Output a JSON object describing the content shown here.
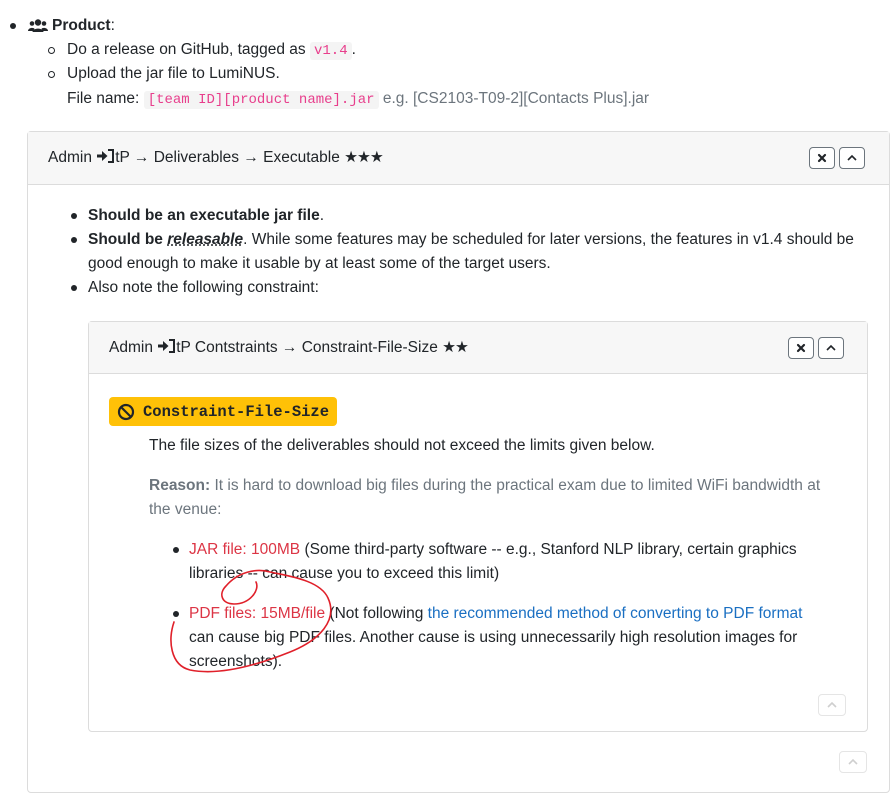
{
  "product": {
    "icon": "users-icon",
    "label": "Product",
    "colon": ":",
    "item1_prefix": "Do a release on GitHub, tagged as",
    "item1_code": "v1.4",
    "item1_suffix": ".",
    "item2_text": "Upload the jar file to LumiNUS.",
    "filename_label": "File name:",
    "filename_code": "[team ID][product name].jar",
    "filename_example": "e.g. [CS2103-T09-2][Contacts Plus].jar"
  },
  "outer_panel": {
    "admin": "Admin",
    "icon": "sign-in-icon",
    "path": "tP → Deliverables → Executable",
    "stars": "★★★",
    "bullet1_bold": "Should be an executable jar file",
    "bullet1_end": ".",
    "bullet2_bold": "Should be",
    "bullet2_bold_italic": "releasable",
    "bullet2_line1": ". While some features may be scheduled for later versions, the features in v1.4 should be",
    "bullet2_line2": "good enough to make it usable by at least some of the target users.",
    "bullet3": "Also note the following constraint:"
  },
  "inner_panel": {
    "admin": "Admin",
    "icon": "sign-in-icon",
    "path": "tP Contstraints → Constraint-File-Size",
    "stars": "★★",
    "badge_icon": "ban-icon",
    "badge_text": "Constraint-File-Size",
    "description": "The file sizes of the deliverables should not exceed the limits given below.",
    "reason_label": "Reason:",
    "reason_line1": "It is hard to download big files during the practical exam due to limited WiFi bandwidth at",
    "reason_line2": "the venue:",
    "jar_label": "JAR file: 100MB",
    "jar_line1": "(Some third-party software -- e.g., Stanford NLP library, certain graphics",
    "jar_line2": "libraries -- can cause you to exceed this limit)",
    "pdf_label": "PDF files: 15MB/file",
    "pdf_pre": "(Not following",
    "pdf_link": "the recommended method of converting to PDF format",
    "pdf_line2": "can cause big PDF files. Another cause is using unnecessarily high resolution images for",
    "pdf_line3": "screenshots)."
  },
  "annotation": {
    "color": "#e0202a"
  }
}
